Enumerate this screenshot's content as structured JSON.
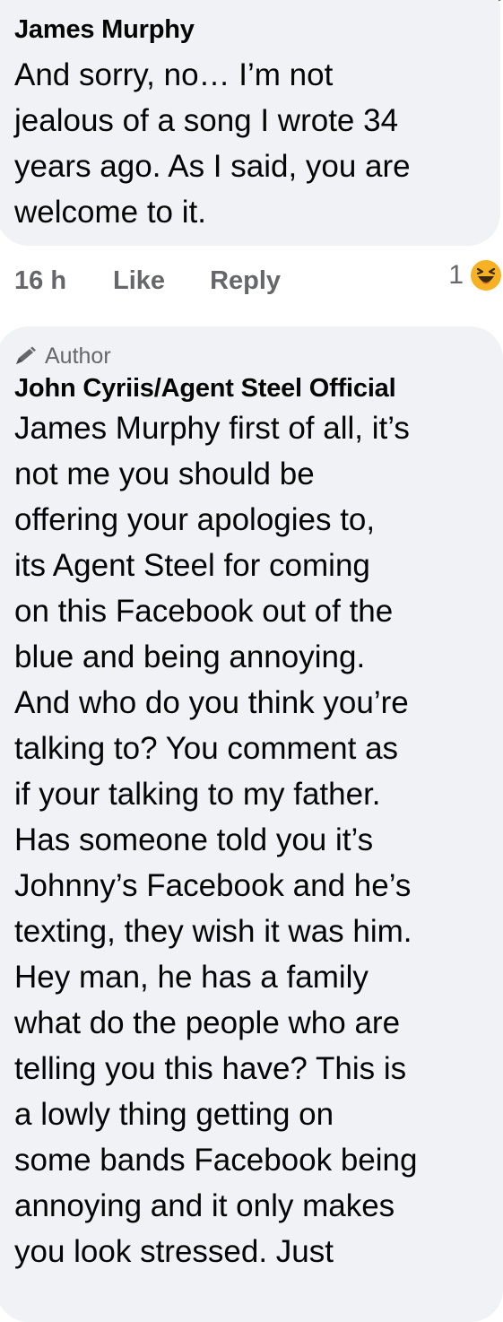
{
  "colors": {
    "bubble_background": "#f0f2f5",
    "text": "#050505",
    "secondary_text": "#65676b",
    "haha_reaction": "#f7b125"
  },
  "comments": [
    {
      "author": "James Murphy",
      "text": "And sorry, no… I’m not\njealous of a song I wrote 34\nyears ago. As I said, you are\nwelcome to it.",
      "actions": {
        "time": "16 h",
        "like_label": "Like",
        "reply_label": "Reply",
        "reaction_count": "1",
        "reaction_icon": "haha-emoji-icon"
      }
    },
    {
      "badge": "Author",
      "badge_icon": "pencil-icon",
      "author": "John Cyriis/Agent Steel Official",
      "text": "James Murphy first of all, it’s\nnot me you should be\noffering your apologies to,\nits Agent Steel for coming\non this Facebook out of the\nblue and being annoying.\nAnd who do you think you’re\ntalking to? You comment as\nif your talking to my father.\nHas someone told you it’s\nJohnny’s Facebook and he’s\ntexting, they wish it was him.\nHey man, he has a family\nwhat do the people who are\ntelling you this have? This is\na lowly thing getting on\nsome bands Facebook being\nannoying and it only makes\nyou look stressed. Just"
    }
  ]
}
